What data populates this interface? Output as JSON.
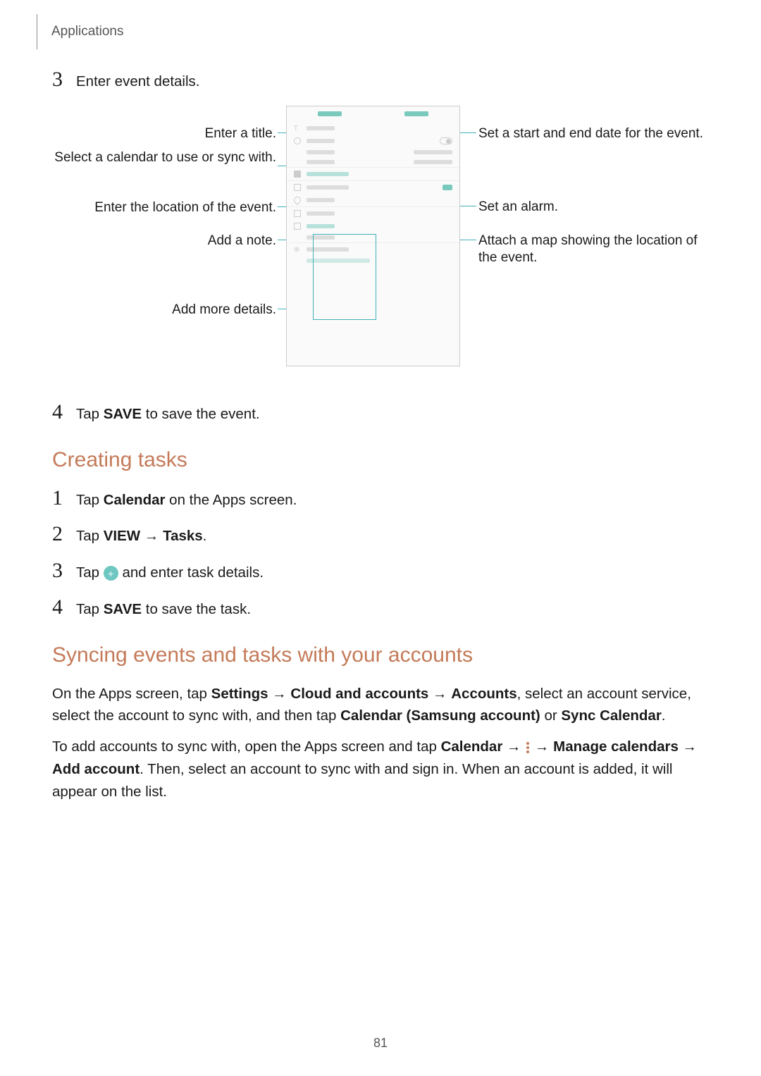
{
  "header": {
    "section": "Applications"
  },
  "step3": {
    "num": "3",
    "text": "Enter event details."
  },
  "diagram": {
    "left": {
      "title": "Enter a title.",
      "calendar": "Select a calendar to use or sync with.",
      "location": "Enter the location of the event.",
      "note": "Add a note.",
      "more": "Add more details."
    },
    "right": {
      "dates": "Set a start and end date for the event.",
      "alarm": "Set an alarm.",
      "map": "Attach a map showing the location of the event."
    }
  },
  "step4": {
    "num": "4",
    "pre": "Tap ",
    "bold": "SAVE",
    "post": " to save the event."
  },
  "creating_tasks": {
    "heading": "Creating tasks",
    "s1": {
      "num": "1",
      "pre": "Tap ",
      "bold": "Calendar",
      "post": " on the Apps screen."
    },
    "s2": {
      "num": "2",
      "pre": "Tap ",
      "b1": "VIEW",
      "arrow": " → ",
      "b2": "Tasks",
      "post": "."
    },
    "s3": {
      "num": "3",
      "pre": "Tap ",
      "post": " and enter task details."
    },
    "s4": {
      "num": "4",
      "pre": "Tap ",
      "bold": "SAVE",
      "post": " to save the task."
    }
  },
  "syncing": {
    "heading": "Syncing events and tasks with your accounts",
    "p1": {
      "t1": "On the Apps screen, tap ",
      "b1": "Settings",
      "a1": " → ",
      "b2": "Cloud and accounts",
      "a2": " → ",
      "b3": "Accounts",
      "t2": ", select an account service, select the account to sync with, and then tap ",
      "b4": "Calendar (Samsung account)",
      "t3": " or ",
      "b5": "Sync Calendar",
      "t4": "."
    },
    "p2": {
      "t1": "To add accounts to sync with, open the Apps screen and tap ",
      "b1": "Calendar",
      "a1": " → ",
      "a2": " → ",
      "b2": "Manage calendars",
      "a3": " → ",
      "b3": "Add account",
      "t2": ". Then, select an account to sync with and sign in. When an account is added, it will appear on the list."
    }
  },
  "page": "81"
}
